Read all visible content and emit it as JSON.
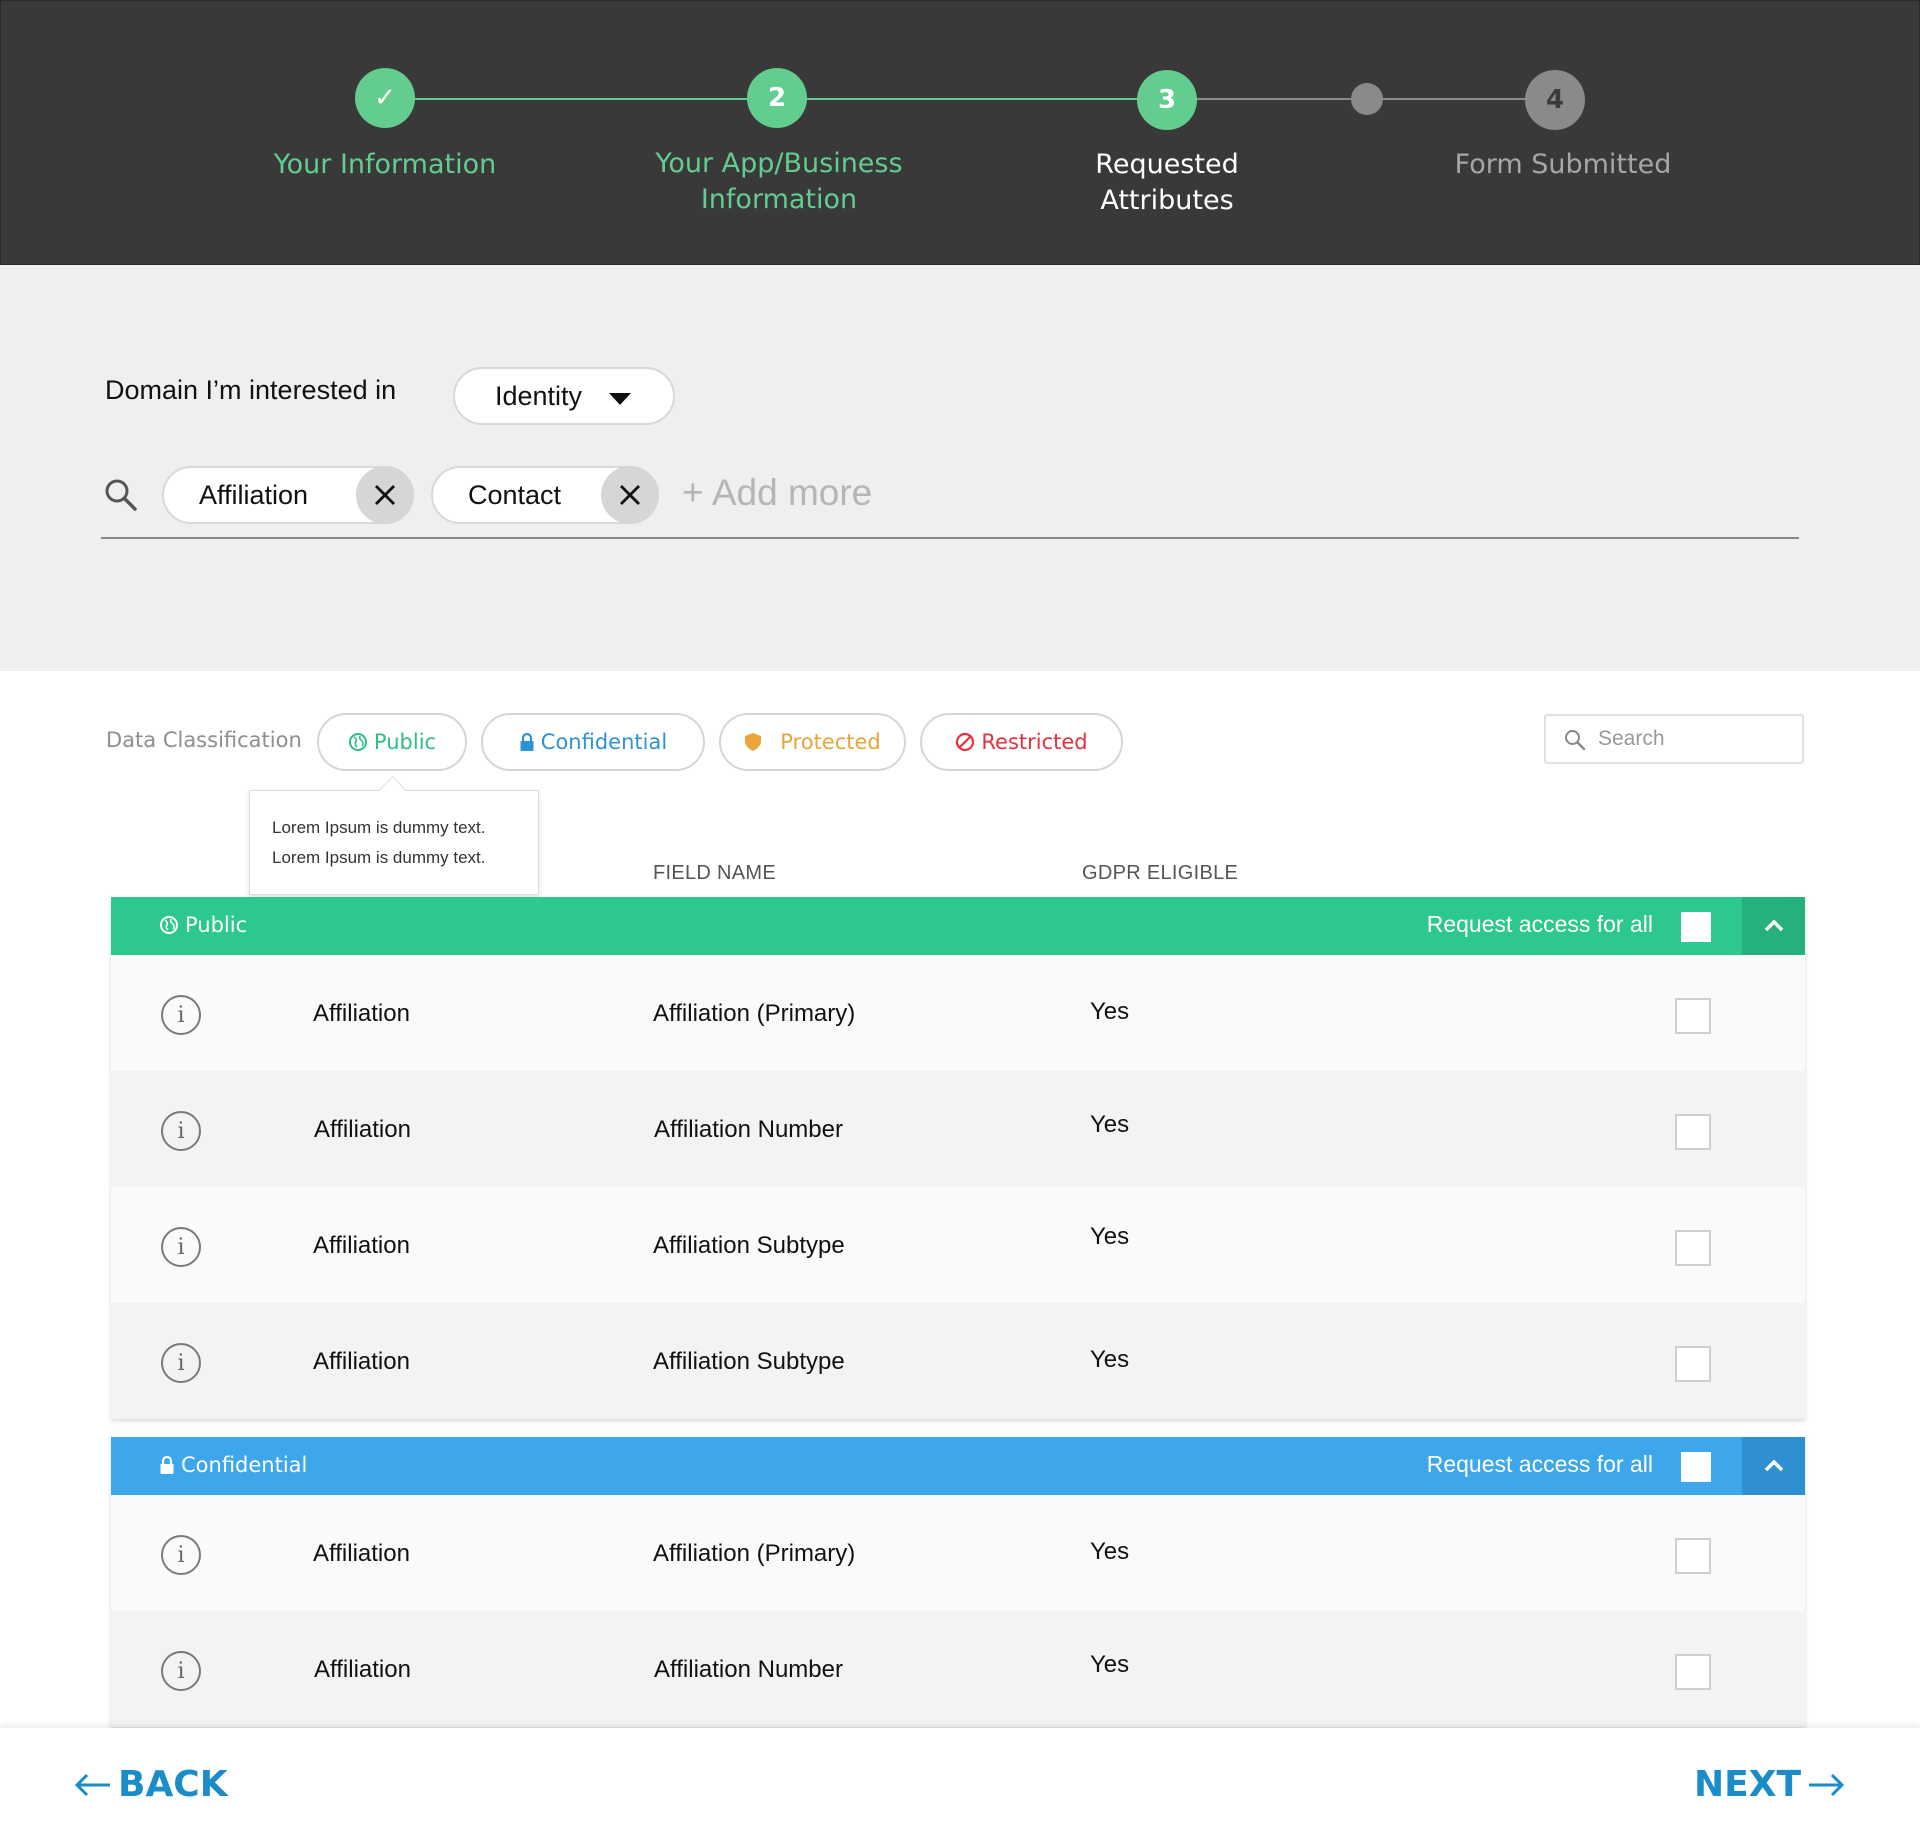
{
  "stepper": {
    "steps": [
      {
        "label": "Your Information",
        "badge": "✓",
        "state": "completed"
      },
      {
        "label": "Your App/Business Information",
        "badge": "2",
        "state": "completed"
      },
      {
        "label": "Requested Attributes",
        "badge": "3",
        "state": "current"
      },
      {
        "label": "Form Submitted",
        "badge": "4",
        "state": "pending"
      }
    ],
    "colors": {
      "done": "#63cd8f",
      "current_label": "#ffffff",
      "pending": "#8a8a8a",
      "pending_label": "#a6a6a6",
      "line_pending": "#8a8a8a"
    }
  },
  "filter": {
    "domain_label": "Domain I’m interested in",
    "domain_value": "Identity",
    "chips": [
      "Affiliation",
      "Contact"
    ],
    "add_more": "+ Add more"
  },
  "classification": {
    "label": "Data Classification",
    "pills": [
      {
        "label": "Public",
        "icon": "globe-icon",
        "color": "#2fbf85"
      },
      {
        "label": "Confidential",
        "icon": "lock-icon",
        "color": "#2e93d6"
      },
      {
        "label": "Protected",
        "icon": "shield-icon",
        "color": "#eaa43a"
      },
      {
        "label": "Restricted",
        "icon": "no-entry-icon",
        "color": "#e2333f"
      }
    ],
    "search_placeholder": "Search",
    "tooltip_lines": [
      "Lorem Ipsum is dummy text.",
      "Lorem Ipsum is dummy text."
    ]
  },
  "columns": {
    "field_name": "FIELD NAME",
    "gdpr": "GDPR ELIGIBLE"
  },
  "groups": [
    {
      "title": "Public",
      "color": "#2dc88e",
      "collapse_color": "#26b07d",
      "request_all": "Request access for all",
      "rows": [
        {
          "category": "Affiliation",
          "field": "Affiliation (Primary)",
          "gdpr": "Yes"
        },
        {
          "category": "Affiliation",
          "field": "Affiliation Number",
          "gdpr": "Yes"
        },
        {
          "category": "Affiliation",
          "field": "Affiliation Subtype",
          "gdpr": "Yes"
        },
        {
          "category": "Affiliation",
          "field": "Affiliation Subtype",
          "gdpr": "Yes"
        }
      ]
    },
    {
      "title": "Confidential",
      "color": "#3ea6ea",
      "collapse_color": "#2e8fd1",
      "request_all": "Request access for all",
      "rows": [
        {
          "category": "Affiliation",
          "field": "Affiliation (Primary)",
          "gdpr": "Yes"
        },
        {
          "category": "Affiliation",
          "field": "Affiliation Number",
          "gdpr": "Yes"
        }
      ]
    }
  ],
  "footer": {
    "back": "BACK",
    "next": "NEXT"
  }
}
